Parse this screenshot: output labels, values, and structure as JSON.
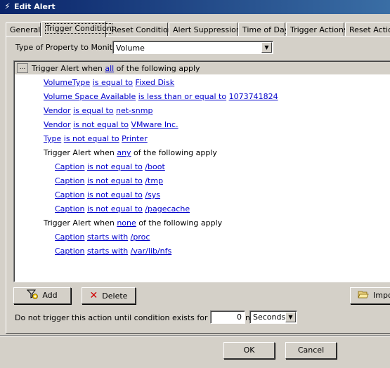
{
  "window": {
    "title": "Edit Alert",
    "icon": "lightning-icon"
  },
  "tabs": [
    {
      "label": "General",
      "active": false
    },
    {
      "label": "Trigger Condition",
      "active": true
    },
    {
      "label": "Reset Condition",
      "active": false
    },
    {
      "label": "Alert Suppression",
      "active": false
    },
    {
      "label": "Time of Day",
      "active": false
    },
    {
      "label": "Trigger Actions",
      "active": false
    },
    {
      "label": "Reset Action",
      "active": false
    }
  ],
  "property": {
    "label": "Type of Property to Monitor:",
    "value": "Volume"
  },
  "tree": {
    "ellipsis": "...",
    "root": {
      "prefix": "Trigger Alert when ",
      "quantifier": "all",
      "suffix": " of the following apply"
    },
    "conditions": [
      {
        "field": "VolumeType",
        "op": "is equal to",
        "value": "Fixed Disk"
      },
      {
        "field": "Volume Space Available",
        "op": "is less than or equal to",
        "value": "1073741824"
      },
      {
        "field": "Vendor",
        "op": "is equal to",
        "value": "net-snmp"
      },
      {
        "field": "Vendor",
        "op": "is not equal to",
        "value": "VMware Inc."
      },
      {
        "field": "Type",
        "op": "is not equal to",
        "value": "Printer"
      }
    ],
    "group_any": {
      "prefix": "Trigger Alert when ",
      "quantifier": "any",
      "suffix": " of the following apply",
      "conditions": [
        {
          "field": "Caption",
          "op": "is not equal to",
          "value": "/boot"
        },
        {
          "field": "Caption",
          "op": "is not equal to",
          "value": "/tmp"
        },
        {
          "field": "Caption",
          "op": "is not equal to",
          "value": "/sys"
        },
        {
          "field": "Caption",
          "op": "is not equal to",
          "value": "/pagecache"
        }
      ]
    },
    "group_none": {
      "prefix": "Trigger Alert when ",
      "quantifier": "none",
      "suffix": " of the following apply",
      "conditions": [
        {
          "field": "Caption",
          "op": "starts with",
          "value": "/proc"
        },
        {
          "field": "Caption",
          "op": "starts with",
          "value": "/var/lib/nfs"
        }
      ]
    }
  },
  "buttons": {
    "add": "Add",
    "delete": "Delete",
    "import": "Impo",
    "ok": "OK",
    "cancel": "Cancel"
  },
  "delay": {
    "label": "Do not trigger this action until condition exists for more than",
    "value": "0",
    "unit": "Seconds"
  },
  "colors": {
    "link": "#0000cc",
    "titlebar": "#0a246a",
    "face": "#d4d0c8"
  }
}
